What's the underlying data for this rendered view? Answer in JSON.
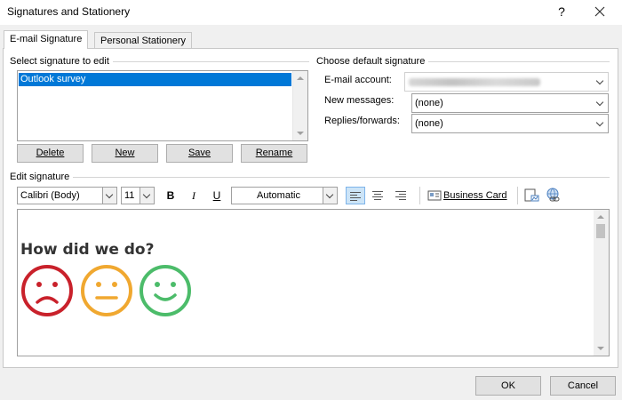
{
  "window": {
    "title": "Signatures and Stationery",
    "help_glyph": "?",
    "close_glyph": "✕"
  },
  "tabs": [
    {
      "label": "E-mail Signature"
    },
    {
      "label": "Personal Stationery"
    }
  ],
  "select_signature": {
    "label": "Select signature to edit",
    "items": [
      "Outlook survey"
    ],
    "buttons": {
      "delete": "Delete",
      "new": "New",
      "save": "Save",
      "rename": "Rename"
    }
  },
  "default_signature": {
    "label": "Choose default signature",
    "email_account_label": "E-mail account:",
    "new_messages_label": "New messages:",
    "new_messages_value": "(none)",
    "replies_label": "Replies/forwards:",
    "replies_value": "(none)"
  },
  "edit_signature": {
    "label": "Edit signature",
    "font": "Calibri (Body)",
    "size": "11",
    "bold": "B",
    "italic": "I",
    "underline": "U",
    "color": "Automatic",
    "business_card": "Business Card",
    "content": {
      "heading": "How did we do?",
      "faces": [
        {
          "mood": "sad",
          "color": "#c9212b"
        },
        {
          "mood": "neutral",
          "color": "#f0a830"
        },
        {
          "mood": "happy",
          "color": "#4cbc6a"
        }
      ]
    }
  },
  "footer": {
    "ok": "OK",
    "cancel": "Cancel"
  },
  "colors": {
    "selection": "#0078d7"
  }
}
